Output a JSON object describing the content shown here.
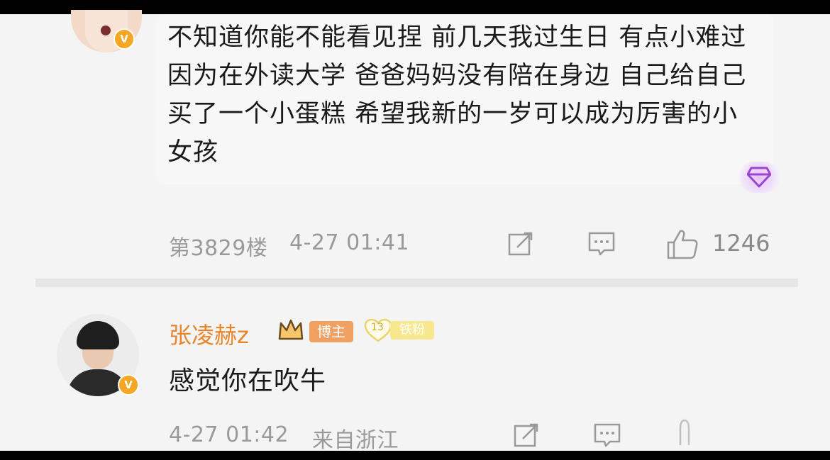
{
  "comment": {
    "text": "不知道你能不能看见捏 前几天我过生日 有点小难过因为在外读大学 爸爸妈妈没有陪在身边 自己给自己买了一个小蛋糕 希望我新的一岁可以成为厉害的小女孩",
    "floor": "第3829楼",
    "time": "4-27 01:41",
    "like_count": "1246"
  },
  "reply": {
    "username": "张凌赫z",
    "badge_blogger": "博主",
    "badge_level": "13",
    "badge_fan": "铁粉",
    "text": "感觉你在吹牛",
    "time": "4-27 01:42",
    "location": "来自浙江"
  },
  "icons": {
    "verified": "V",
    "gem": "gem-icon",
    "share": "share-icon",
    "comment": "comment-icon",
    "like": "thumbs-up-icon",
    "crown": "crown-icon"
  },
  "colors": {
    "username": "#e8842a",
    "verified_badge": "#f5a623",
    "meta_text": "#999999",
    "body_text": "#1a1a1a"
  }
}
